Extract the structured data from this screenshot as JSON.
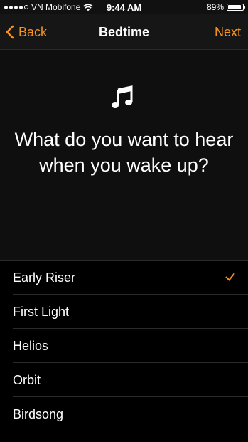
{
  "status_bar": {
    "carrier": "VN Mobifone",
    "time": "9:44 AM",
    "battery_percent_text": "89%",
    "battery_level": 0.89,
    "signal_bars_filled": 4,
    "signal_bars_total": 5,
    "icons": [
      "signal-dots-icon",
      "wifi-icon",
      "battery-icon"
    ]
  },
  "nav": {
    "back_label": "Back",
    "title": "Bedtime",
    "next_label": "Next",
    "icons": [
      "chevron-left-icon"
    ]
  },
  "hero": {
    "icon": "music-note-icon",
    "question": "What do you want to hear when you wake up?"
  },
  "sound_list": {
    "selected_index": 0,
    "items": [
      {
        "label": "Early Riser"
      },
      {
        "label": "First Light"
      },
      {
        "label": "Helios"
      },
      {
        "label": "Orbit"
      },
      {
        "label": "Birdsong"
      }
    ]
  },
  "colors": {
    "accent": "#f7941e",
    "background": "#000000",
    "nav_background": "#161616",
    "text": "#ffffff"
  }
}
